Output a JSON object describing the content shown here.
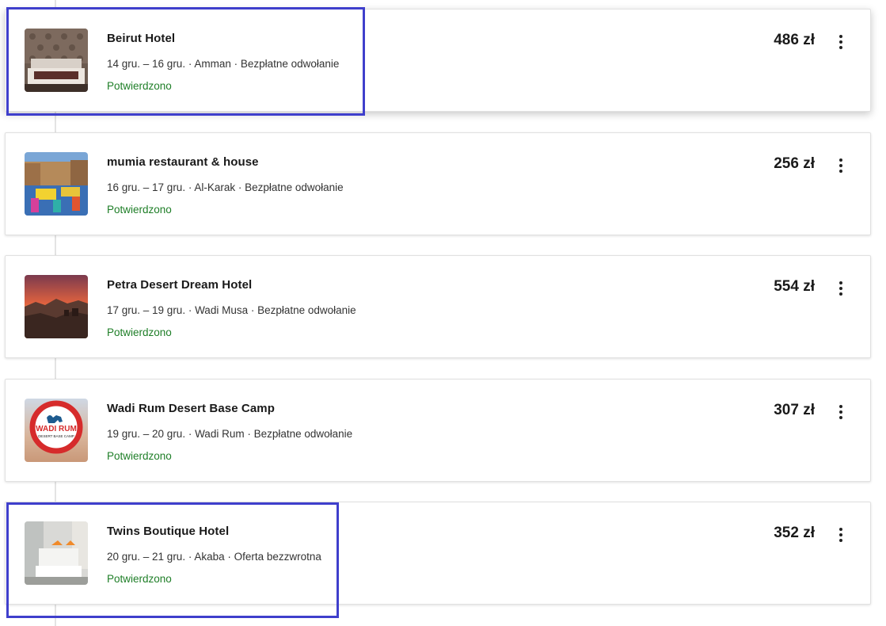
{
  "bookings": [
    {
      "name": "Beirut Hotel",
      "details": "14 gru. – 16 gru. · Amman · Bezpłatne odwołanie",
      "status": "Potwierdzono",
      "price": "486 zł",
      "thumbnail": "hotel-bedroom-photo"
    },
    {
      "name": "mumia restaurant & house",
      "details": "16 gru. – 17 gru. · Al-Karak · Bezpłatne odwołanie",
      "status": "Potwierdzono",
      "price": "256 zł",
      "thumbnail": "rooftop-terrace-photo"
    },
    {
      "name": "Petra Desert Dream Hotel",
      "details": "17 gru. – 19 gru. · Wadi Musa · Bezpłatne odwołanie",
      "status": "Potwierdzono",
      "price": "554 zł",
      "thumbnail": "desert-sunset-photo"
    },
    {
      "name": "Wadi Rum Desert Base Camp",
      "details": "19 gru. – 20 gru. · Wadi Rum · Bezpłatne odwołanie",
      "status": "Potwierdzono",
      "price": "307 zł",
      "thumbnail": "camp-logo-photo",
      "logo_text": "WADI RUM",
      "logo_subtext": "DESERT BASE CAMP"
    },
    {
      "name": "Twins Boutique Hotel",
      "details": "20 gru. – 21 gru. · Akaba · Oferta bezzwrotna",
      "status": "Potwierdzono",
      "price": "352 zł",
      "thumbnail": "boutique-room-photo"
    }
  ],
  "colors": {
    "status_green": "#1e7e27",
    "highlight": "#3f3fcc",
    "logo_red": "#d62b2b"
  },
  "icons": {
    "more": "more-vertical-icon"
  }
}
